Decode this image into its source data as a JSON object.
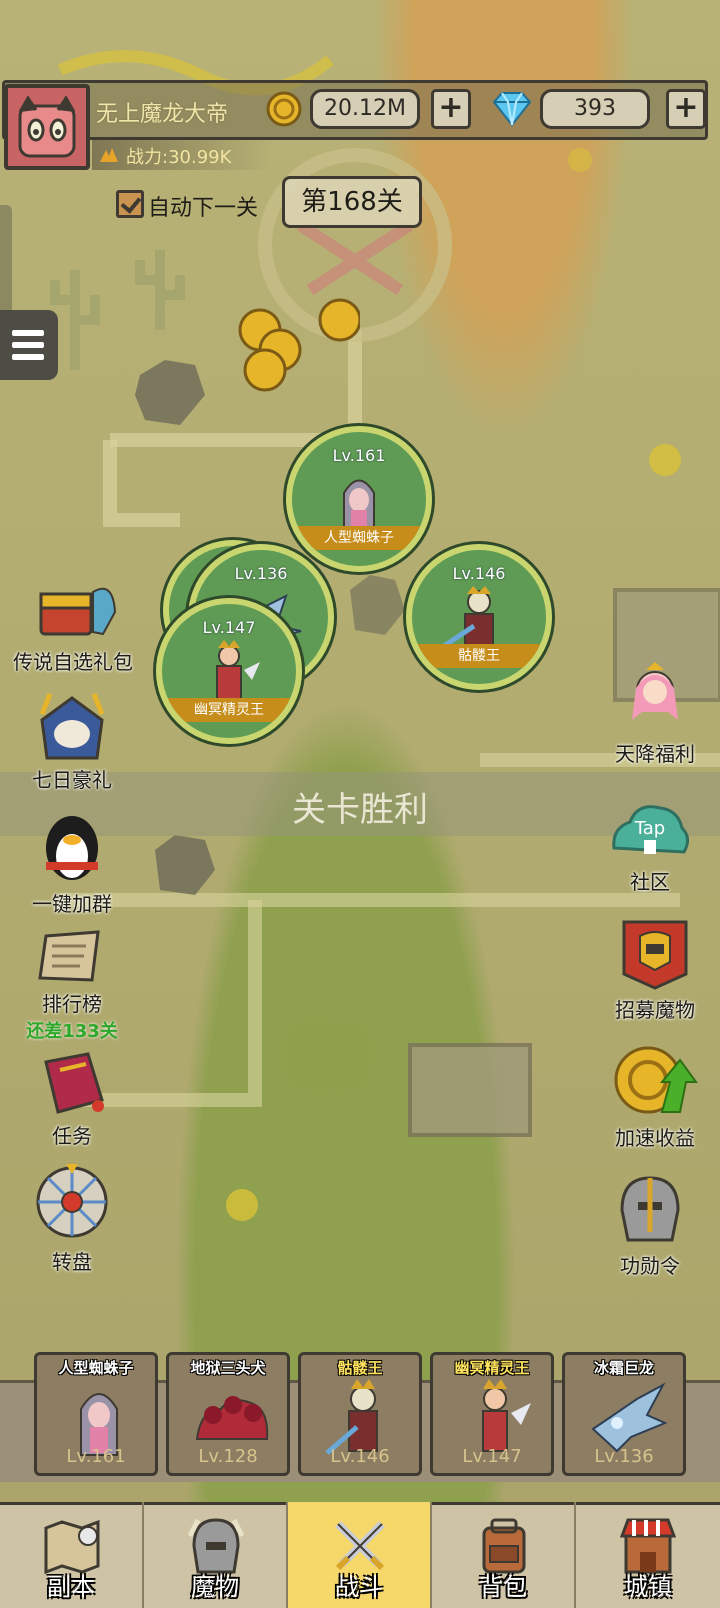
{
  "player": {
    "name": "无上魔龙大帝",
    "power": "战力:30.99K"
  },
  "resources": {
    "gold": "20.12M",
    "gems": "393",
    "plus": "+"
  },
  "stage": {
    "auto_label": "自动下一关",
    "auto_checked": true,
    "current": "第168关"
  },
  "battle_monsters": [
    {
      "level": "Lv.161",
      "name": "人型蜘蛛子"
    },
    {
      "level": "Lv.136",
      "name": ""
    },
    {
      "level": "Lv.146",
      "name": "骷髅王"
    },
    {
      "level": "Lv.147",
      "name": "幽冥精灵王"
    }
  ],
  "victory_text": "关卡胜利",
  "left_features": [
    {
      "label": "传说自选礼包",
      "icon": "treasure-chest-icon"
    },
    {
      "label": "七日豪礼",
      "icon": "knight-icon"
    },
    {
      "label": "一键加群",
      "icon": "penguin-icon"
    },
    {
      "label": "排行榜",
      "sub": "还差133关",
      "icon": "scroll-icon"
    },
    {
      "label": "任务",
      "icon": "book-icon"
    },
    {
      "label": "转盘",
      "icon": "wheel-icon"
    }
  ],
  "right_features": [
    {
      "label": "天降福利",
      "icon": "girl-icon"
    },
    {
      "label": "社区",
      "icon": "tap-icon",
      "icon_text": "Tap"
    },
    {
      "label": "招募魔物",
      "icon": "banner-icon"
    },
    {
      "label": "加速收益",
      "icon": "coin-arrow-icon"
    },
    {
      "label": "功勋令",
      "icon": "helmet-icon"
    }
  ],
  "team": [
    {
      "name": "人型蜘蛛子",
      "level": "Lv.161",
      "gold_name": false
    },
    {
      "name": "地狱三头犬",
      "level": "Lv.128",
      "gold_name": false
    },
    {
      "name": "骷髅王",
      "level": "Lv.146",
      "gold_name": true
    },
    {
      "name": "幽冥精灵王",
      "level": "Lv.147",
      "gold_name": true
    },
    {
      "name": "冰霜巨龙",
      "level": "Lv.136",
      "gold_name": false
    }
  ],
  "nav": [
    {
      "label": "副本",
      "icon": "map-icon"
    },
    {
      "label": "魔物",
      "icon": "monster-helmet-icon"
    },
    {
      "label": "战斗",
      "icon": "crossed-swords-icon",
      "active": true
    },
    {
      "label": "背包",
      "icon": "backpack-icon"
    },
    {
      "label": "城镇",
      "icon": "shop-icon"
    }
  ]
}
